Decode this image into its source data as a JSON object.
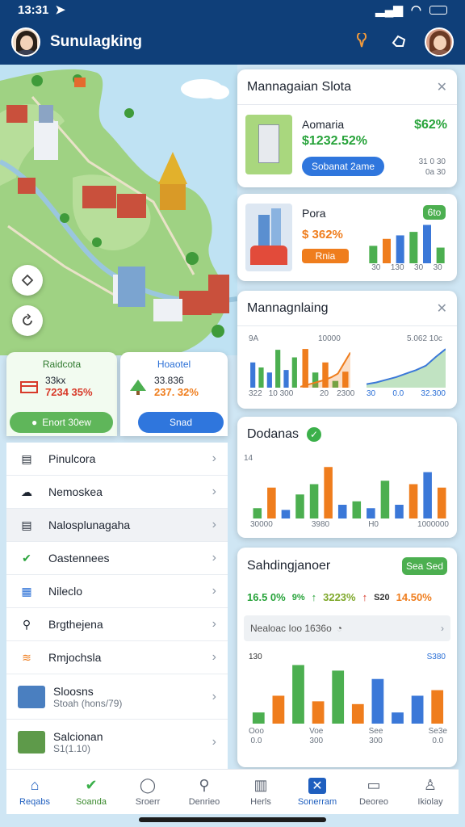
{
  "status": {
    "time": "13:31"
  },
  "app": {
    "title": "Sunulagking"
  },
  "map_panels": {
    "left": {
      "title": "Raidcota",
      "line1": "33kx",
      "line2": "7234 35%",
      "button": "Enort 30ew"
    },
    "right": {
      "title": "Hoaotel",
      "line1": "33.836",
      "line2": "237. 32%",
      "button": "Snad"
    }
  },
  "list": [
    {
      "label": "Pinulcora",
      "sub": ""
    },
    {
      "label": "Nemoskea",
      "sub": ""
    },
    {
      "label": "Nalosplunagaha",
      "sub": ""
    },
    {
      "label": "Oastennees",
      "sub": ""
    },
    {
      "label": "Nileclo",
      "sub": ""
    },
    {
      "label": "Brgthejena",
      "sub": ""
    },
    {
      "label": "Rmjochsla",
      "sub": ""
    },
    {
      "label": "Sloosns",
      "sub": "Stoah (hons/79)"
    },
    {
      "label": "Salcionan",
      "sub": "S1(1.10)"
    }
  ],
  "card1": {
    "title": "Mannagaian Slota",
    "name": "Aomaria",
    "value": "$1232.52%",
    "pct": "$62%",
    "button": "Sobanat 2ame",
    "side1": "31 0 30",
    "side2": "0a 30"
  },
  "card2": {
    "title": "Pora",
    "value": "$ 362%",
    "chip": "6to",
    "button": "Rnia",
    "labels": [
      "30",
      "130",
      "30",
      "30"
    ]
  },
  "card3": {
    "title": "Mannagnlaing",
    "c1_top": "9A",
    "c1_bottom": [
      "322",
      "10 300"
    ],
    "c2_top": "10000",
    "c2_bottom": [
      "20",
      "2300"
    ],
    "c3_top": "5.062 10c",
    "c3_bottom": [
      "30",
      "0.0",
      "32.300"
    ]
  },
  "card4": {
    "title": "Dodanas",
    "ytick": "14",
    "xlabels": [
      "30000",
      "3980",
      "H0",
      "1000000"
    ]
  },
  "card5": {
    "title": "Sahdingjanoer",
    "button": "Sea Sed",
    "stats": [
      "16.5 0%",
      "9%",
      "3223%",
      "S20",
      "14.50%"
    ],
    "search": "Nealoac Ioo 1636o",
    "ytick": "130",
    "yright": "S380",
    "xlabels": [
      [
        "Ooo",
        "0.0"
      ],
      [
        "Voe",
        "300"
      ],
      [
        "See",
        "300"
      ],
      [
        "Se3e",
        "0.0"
      ]
    ]
  },
  "tabs": [
    "Reqabs",
    "Soanda",
    "Sroerr",
    "Denrieo",
    "Herls",
    "Sonerram",
    "Deoreo",
    "Ikiolay"
  ],
  "chart_data": [
    {
      "type": "bar",
      "title": "",
      "categories": [
        "a",
        "b",
        "c",
        "d",
        "e"
      ],
      "series": [
        {
          "values": [
            20,
            28,
            32,
            36,
            44
          ]
        }
      ]
    },
    {
      "type": "bar",
      "title": "",
      "categories": [
        "a",
        "b",
        "c",
        "d",
        "e",
        "f"
      ],
      "series": [
        {
          "values": [
            10,
            8,
            6,
            15,
            7,
            12
          ]
        }
      ]
    },
    {
      "type": "bar",
      "title": "",
      "categories": [
        "a",
        "b",
        "c",
        "d",
        "e"
      ],
      "series": [
        {
          "values": [
            46,
            18,
            30,
            8,
            19
          ]
        }
      ]
    },
    {
      "type": "bar",
      "title": "",
      "categories": [
        "a",
        "b",
        "c",
        "d",
        "e",
        "f",
        "g"
      ],
      "series": [
        {
          "values": [
            40,
            16,
            24,
            6,
            30,
            35,
            12
          ]
        }
      ]
    },
    {
      "type": "area",
      "title": "",
      "x": [
        0,
        1,
        2,
        3,
        4,
        5,
        6,
        7,
        8
      ],
      "series": [
        {
          "values": [
            4,
            6,
            9,
            12,
            16,
            20,
            25,
            35,
            44
          ]
        }
      ]
    },
    {
      "type": "area",
      "title": "",
      "x": [
        0,
        1,
        2,
        3,
        4,
        5,
        6,
        7,
        8
      ],
      "series": [
        {
          "values": [
            1,
            3,
            5,
            7,
            9,
            12,
            16,
            28,
            40
          ]
        }
      ]
    },
    {
      "type": "bar",
      "title": "",
      "categories": [
        "30000",
        "3980",
        "H0",
        "1000000"
      ],
      "series": [
        {
          "values": [
            6,
            18,
            5,
            14,
            20,
            30,
            8,
            10,
            6,
            22,
            8,
            20,
            27,
            18
          ]
        }
      ]
    },
    {
      "type": "bar",
      "title": "",
      "categories": [
        "Ooo",
        "Voe",
        "See",
        "Se3e"
      ],
      "series": [
        {
          "values": [
            8,
            20,
            42,
            16,
            38,
            14,
            32,
            8,
            20,
            24
          ]
        }
      ]
    }
  ],
  "colors": {
    "primary": "#0f3f79",
    "green": "#4caf50",
    "orange": "#ef7d1d",
    "blue": "#3b78d8",
    "red": "#d83a2a"
  }
}
